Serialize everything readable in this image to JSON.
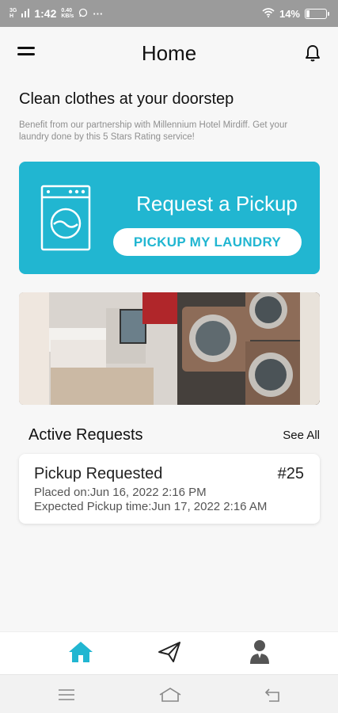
{
  "status_bar": {
    "network": "3G",
    "network_sub": "H",
    "time": "1:42",
    "speed_value": "0.40",
    "speed_unit": "KB/s",
    "more": "···",
    "battery": "14%"
  },
  "header": {
    "title": "Home",
    "menu_icon": "hamburger-icon",
    "notification_icon": "bell-icon"
  },
  "hero": {
    "headline": "Clean clothes at your doorstep",
    "subtext": "Benefit from our partnership with Millennium Hotel Mirdiff. Get your laundry done by this 5 Stars Rating service!"
  },
  "pickup_card": {
    "title": "Request a Pickup",
    "button_label": "PICKUP MY LAUNDRY",
    "icon": "washing-machine-icon",
    "color": "#21b6d1"
  },
  "banner": {
    "image": "laundromat-photo"
  },
  "active_requests": {
    "title": "Active Requests",
    "see_all_label": "See All",
    "items": [
      {
        "status": "Pickup Requested",
        "number": "#25",
        "placed": "Placed on:Jun 16, 2022 2:16 PM",
        "expected": "Expected Pickup time:Jun 17, 2022 2:16 AM"
      }
    ]
  },
  "bottom_nav": {
    "items": [
      {
        "icon": "home-icon",
        "active": true
      },
      {
        "icon": "send-icon",
        "active": false
      },
      {
        "icon": "profile-icon",
        "active": false
      }
    ],
    "active_color": "#21b6d1"
  },
  "system_nav": {
    "items": [
      "menu-icon",
      "home-icon",
      "back-icon"
    ]
  }
}
